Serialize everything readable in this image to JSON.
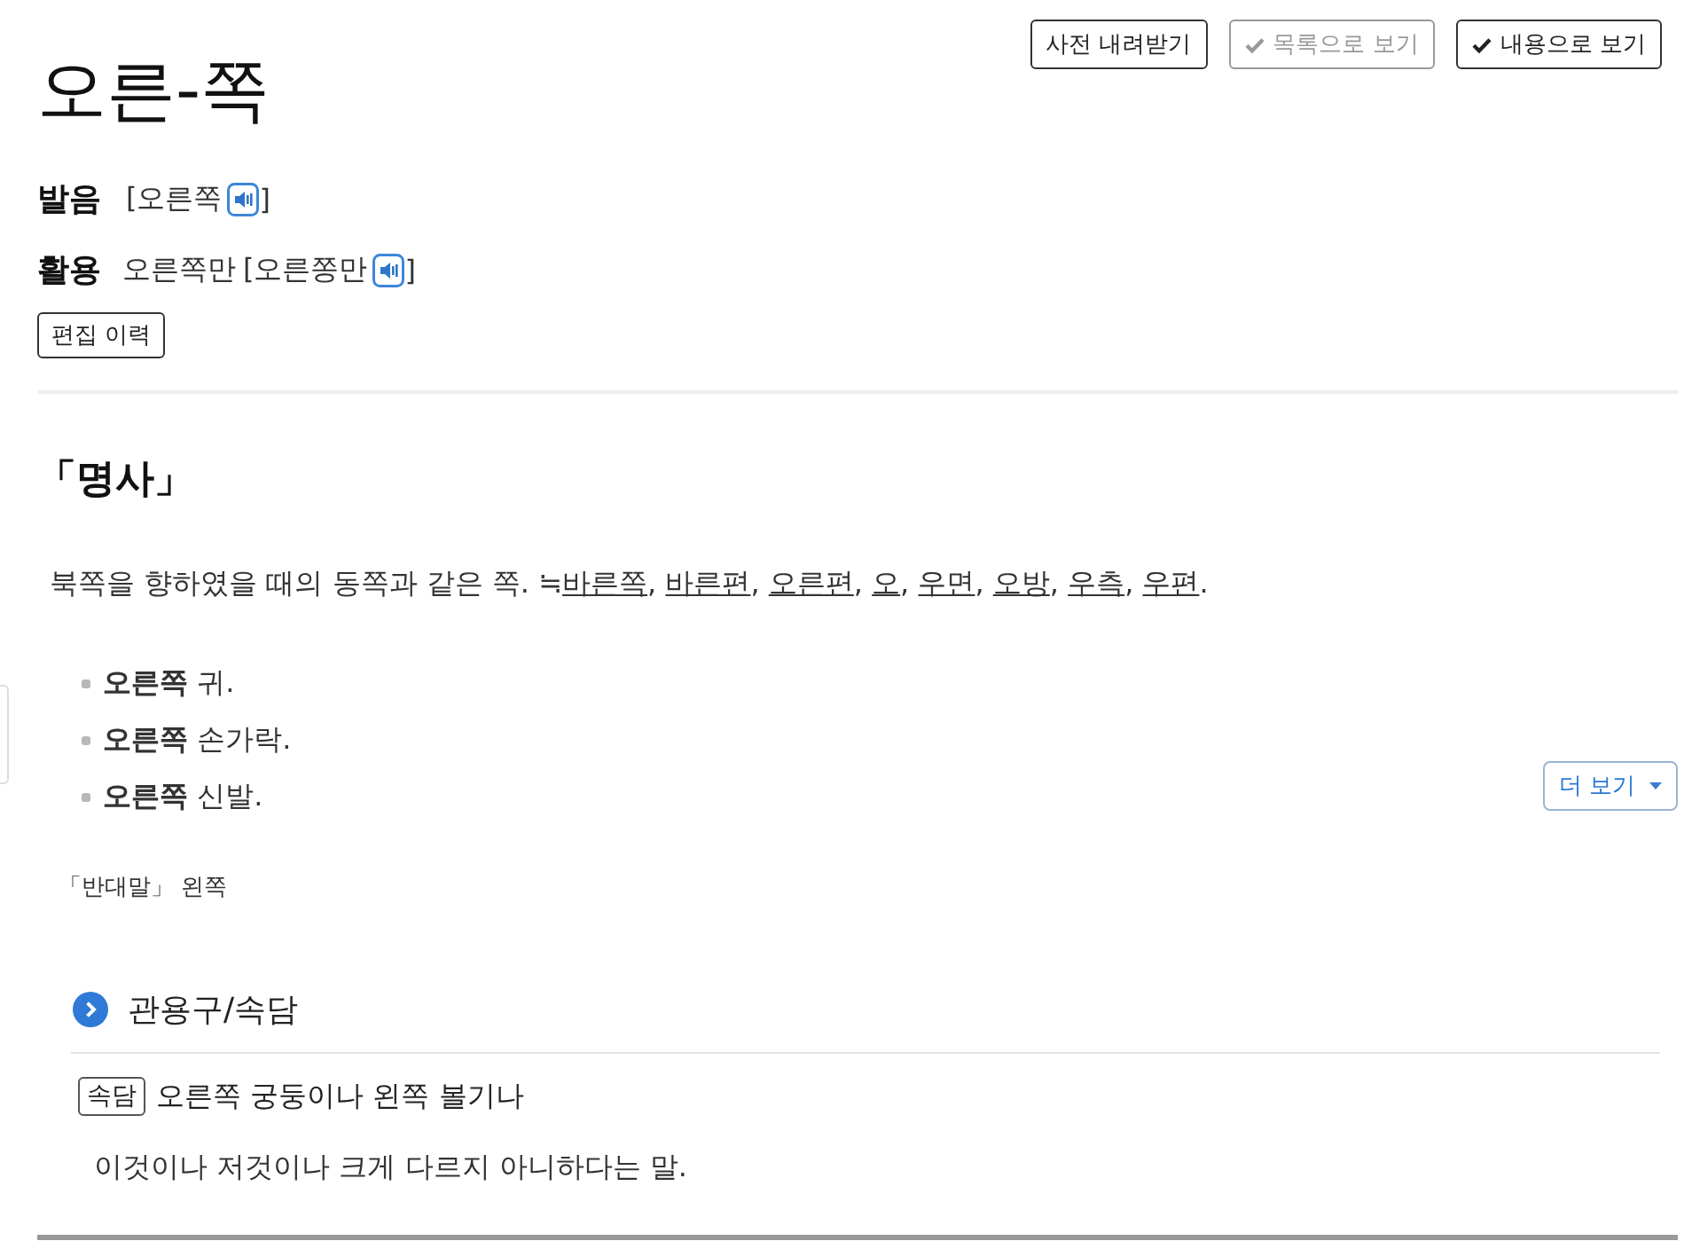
{
  "toolbar": {
    "download_button": "사전 내려받기",
    "view_buttons": [
      {
        "label": "목록으로 보기",
        "selected": false
      },
      {
        "label": "내용으로 보기",
        "selected": true
      }
    ]
  },
  "entry": {
    "headword": "오른-쪽",
    "pronunciation": {
      "label": "발음",
      "open": "[오른쪽",
      "close": "]"
    },
    "conjugation": {
      "label": "활용",
      "form": "오른쪽만",
      "open": "[오른쫑만",
      "close": "]"
    },
    "edit_history_button": "편집 이력"
  },
  "sense": {
    "part_of_speech": "「명사」",
    "definition": "북쪽을 향하였을 때의 동쪽과 같은 쪽.",
    "synonym_mark": "≒",
    "synonyms": [
      {
        "word": "바른쪽",
        "sep": ","
      },
      {
        "word": "바른편",
        "sep": ","
      },
      {
        "word": "오른편",
        "sep": ","
      },
      {
        "word": "오",
        "sep": ","
      },
      {
        "word": "우면",
        "sep": ","
      },
      {
        "word": "오방",
        "sep": ","
      },
      {
        "word": "우측",
        "sep": ","
      },
      {
        "word": "우편",
        "sep": "."
      }
    ],
    "examples": [
      "**오른쪽** 귀.",
      "**오른쪽** 손가락.",
      "**오른쪽** 신발."
    ],
    "more_button": "더 보기",
    "antonym": "「반대말」 왼쪽"
  },
  "idioms": {
    "title": "관용구/속담",
    "items": [
      {
        "tag": "속담",
        "phrase": "오른쪽 궁둥이나 왼쪽 볼기나",
        "meaning": "이것이나 저것이나 크게 다르지 아니하다는 말."
      }
    ]
  }
}
